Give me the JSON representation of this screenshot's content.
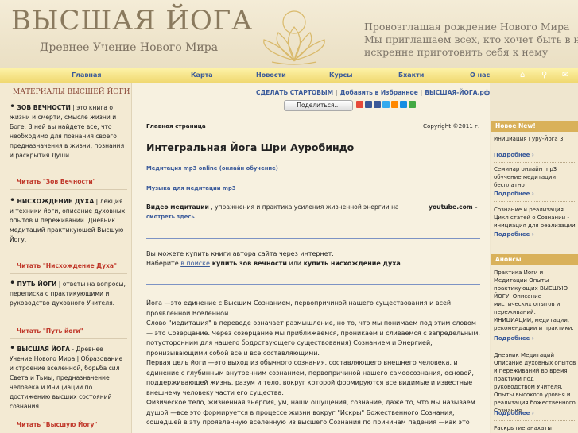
{
  "header": {
    "title": "ВЫСШАЯ ЙОГА",
    "subtitle": "Древнее Учение Нового Мира",
    "slogan": [
      "Провозглашая рождение Нового Мира",
      "Мы приглашаем всех, кто хочет быть в нем,",
      "искренне приготовить себя к нему"
    ]
  },
  "nav": {
    "items": [
      "Главная",
      "Карта",
      "Новости",
      "Курсы",
      "Бхакти",
      "О нас"
    ],
    "icons": [
      "home-icon",
      "search-icon",
      "mail-icon"
    ]
  },
  "sidebar": {
    "heading": "МАТЕРИАЛЫ ВЫСШЕЙ ЙОГИ",
    "items": [
      {
        "title": "ЗОВ ВЕЧНОСТИ",
        "text": " | это книга о жизни и смерти, смысле жизни и Боге. В ней вы найдете все, что необходимо для познания своего предназначения в жизни, познания и раскрытия Души...",
        "link": "Читать \"Зов Вечности\""
      },
      {
        "title": "НИСХОЖДЕНИЕ ДУХА",
        "text": " | лекция и техники йоги, описание духовных опытов и переживаний. Дневник медитаций практикующей Высшую Йогу.",
        "link": "Читать \"Нисхождение Духа\""
      },
      {
        "title": "ПУТЬ ЙОГИ",
        "text": " | ответы на вопросы, переписка с практикующими и руководство духовного Учителя.",
        "link": "Читать \"Путь йоги\""
      },
      {
        "title": "ВЫСШАЯ ЙОГА",
        "text": " - Древнее Учение Нового Мира | Образование и строение вселенной, борьба сил Света и Тьмы, предназначение человека и Инициации по достижению высших состояний сознания.",
        "link": "Читать \"Высшую Йогу\""
      }
    ]
  },
  "main": {
    "toplinks": [
      "СДЕЛАТЬ СТАРТОВЫМ",
      "Добавить в Избранное",
      "ВЫСШАЯ-ЙОГА.рф"
    ],
    "share_label": "Поделиться...",
    "breadcrumb": "Главная страница",
    "copyright": "Copyright ©2011 г.",
    "title": "Интегральная Йога Шри Ауробиндо",
    "link1": "Медитация mp3 online (онлайн обучение)",
    "link2": "Музыка для медитации mp3",
    "video_bold": "Видео медитации",
    "video_text": " , упражнения и практика усиления жизненной энергии на",
    "youtube": "youtube.com",
    "watch": "смотреть здесь",
    "buy_line1": "Вы можете купить книги автора сайта через интернет.",
    "buy_pre": "Наберите ",
    "buy_link": "в поиске",
    "buy_b1": " купить зов вечности",
    "buy_mid": " или ",
    "buy_b2": "купить нисхождение духа",
    "body": [
      "Йога   —это единение с Высшим Сознанием, первопричиной нашего существования и всей проявленной Вселенной.",
      "Слово \"медитация\" в переводе означает размышление, но то, что мы понимаем под этим словом — это Созерцание. Через созерцание мы приближаемся, проникаем и сливаемся с запредельным, потусторонним  для нашего бодрствующего существования) Сознанием и Энергией, пронизывающими собой все и все составляющими.",
      "Первая цель йоги  —это выход из обычного сознания, составляющего внешнего человека, и единение с глубинным внутренним сознанием, первопричиной нашего самоосознания, основой, поддерживающей жизнь, разум и тело, вокруг которой формируются все видимые и известные внешнему человеку части его существа.",
      "Физическое тело, жизненная энергия, ум, наши ощущения, сознание, даже то, что мы называем душой   —все это формируется в процессе жизни вокруг \"Искры\" Божественного Сознания, сошедшей в эту проявленную вселенную из высшего Сознания по причинам падения  —как это"
    ]
  },
  "right": {
    "news_heading": "Новое  New!",
    "items": [
      {
        "text": "Инициация Гуру-Йога 3",
        "more": "Подробнее"
      },
      {
        "text": "Семинар онлайн mp3 обучение медитации бесплатно",
        "more": "Подробнее"
      },
      {
        "text": "Сознание и реализация Цикл статей о Сознании - инициация для реализации",
        "more": "Подробнее"
      }
    ],
    "ann_heading": "Анонсы",
    "ann_items": [
      {
        "text": "Практика Йоги и Медитации Опыты практикующих ВЫСШУЮ ЙОГУ. Описание мистических опытов и переживаний. ИНИЦИАЦИИ, медитации, рекомендации и практики.",
        "more": "Подробнее"
      },
      {
        "text": "Дневник Медитаций Описание духовных опытов и переживаний во время практики под руководством Учителя. Опыты высокого уровня и реализация божественного Сознания.",
        "more": "Подробнее"
      },
      {
        "text": "Раскрытие анахаты",
        "more": ""
      }
    ]
  }
}
